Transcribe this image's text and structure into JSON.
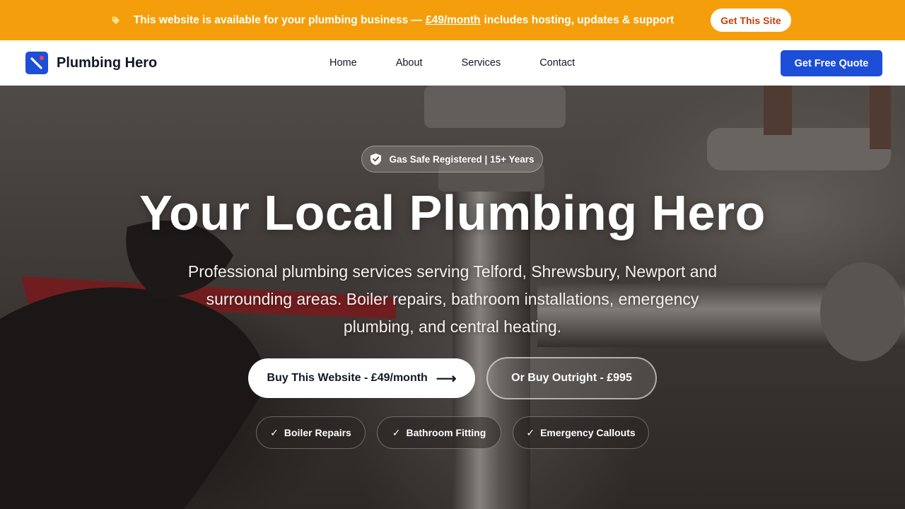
{
  "promo": {
    "text_before": "This website is available for your plumbing business —",
    "price": "£49/month",
    "text_after": "includes hosting, updates & support",
    "button_label": "Get This Site",
    "icon": "tag-icon"
  },
  "nav": {
    "brand": "Plumbing Hero",
    "links": [
      "Home",
      "About",
      "Services",
      "Contact"
    ],
    "cta_label": "Get Free Quote"
  },
  "hero": {
    "badge": "Gas Safe Registered | 15+ Years",
    "title": "Your Local Plumbing Hero",
    "subtitle": "Professional plumbing services serving Telford, Shrewsbury, Newport and surrounding areas. Boiler repairs, bathroom installations, emergency plumbing, and central heating.",
    "primary_button": "Buy This Website - £49/month",
    "primary_arrow": "⟶",
    "secondary_button": "Or Buy Outright - £995",
    "chips": [
      {
        "label": "Boiler Repairs"
      },
      {
        "label": "Bathroom Fitting"
      },
      {
        "label": "Emergency Callouts"
      }
    ],
    "check_glyph": "✓"
  },
  "colors": {
    "promo_bg": "#f59e0b",
    "brand_blue": "#1d4ed8",
    "promo_button_text": "#c2410c"
  }
}
